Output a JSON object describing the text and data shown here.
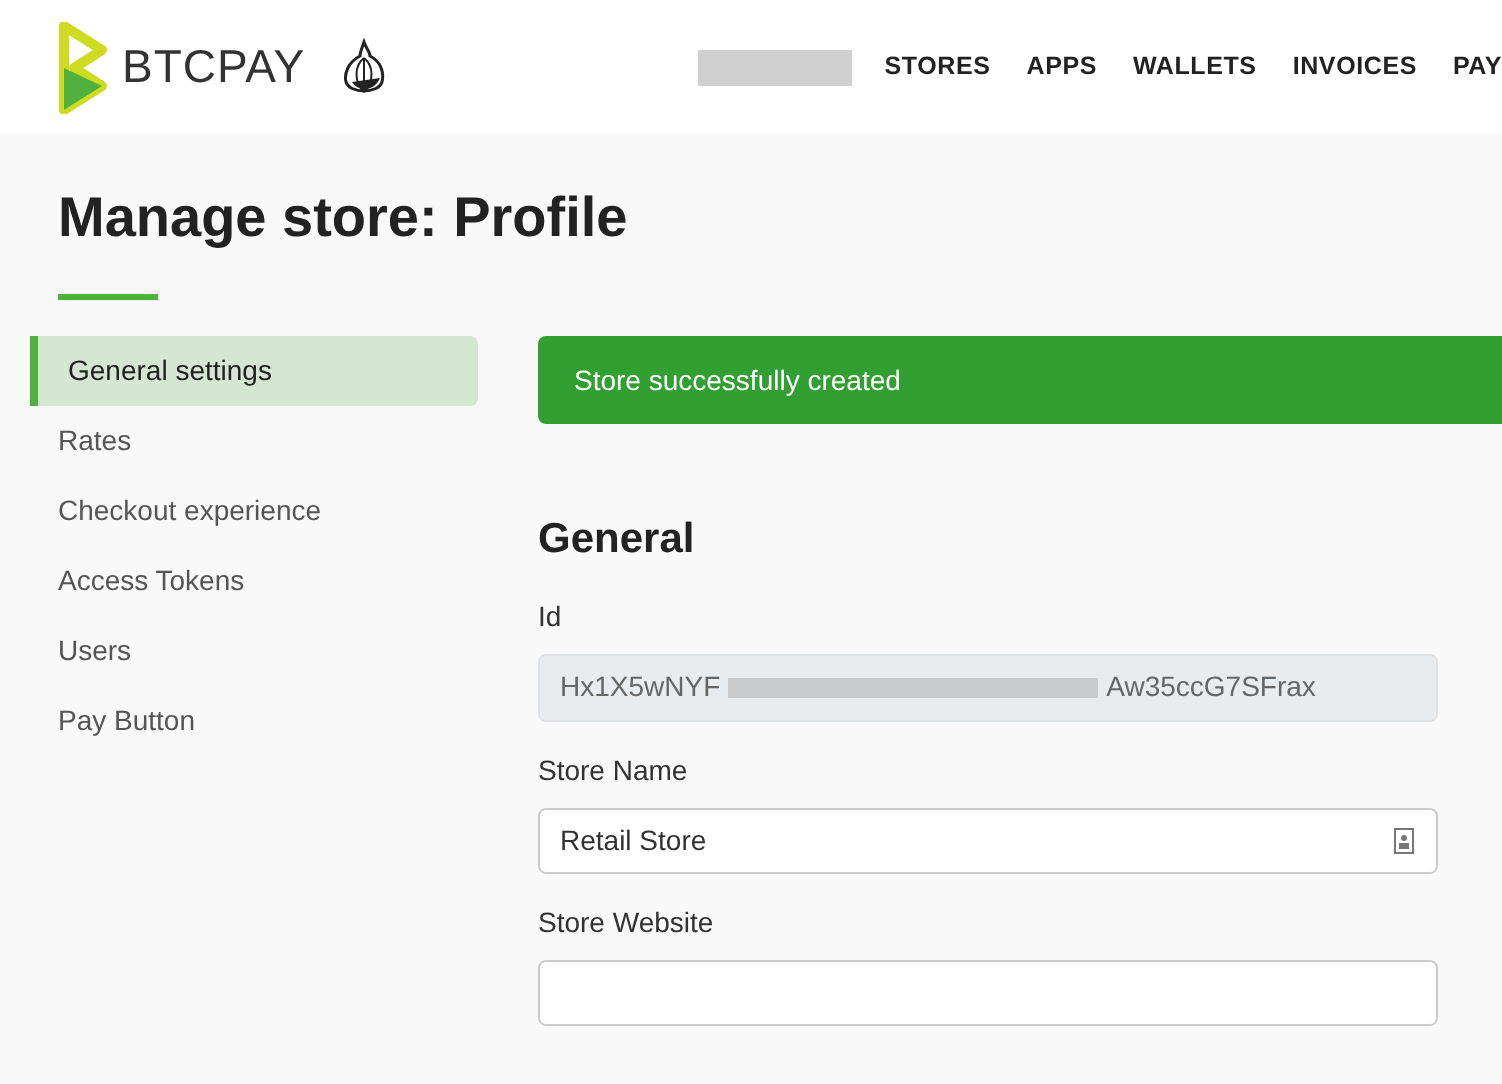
{
  "header": {
    "logo_text": "BTCPAY",
    "nav": [
      {
        "label": "STORES"
      },
      {
        "label": "APPS"
      },
      {
        "label": "WALLETS"
      },
      {
        "label": "INVOICES"
      },
      {
        "label": "PAY"
      }
    ]
  },
  "page_title": "Manage store: Profile",
  "sidebar": {
    "items": [
      {
        "label": "General settings",
        "selected": true
      },
      {
        "label": "Rates",
        "selected": false
      },
      {
        "label": "Checkout experience",
        "selected": false
      },
      {
        "label": "Access Tokens",
        "selected": false
      },
      {
        "label": "Users",
        "selected": false
      },
      {
        "label": "Pay Button",
        "selected": false
      }
    ]
  },
  "alert": "Store successfully created",
  "section_title": "General",
  "fields": [
    {
      "label": "Id",
      "value_start": "Hx1X5wNYF",
      "value_end": "Aw35ccG7SFrax",
      "disabled": true
    },
    {
      "label": "Store Name",
      "value": "Retail Store",
      "disabled": false
    },
    {
      "label": "Store Website",
      "disabled": false
    }
  ]
}
